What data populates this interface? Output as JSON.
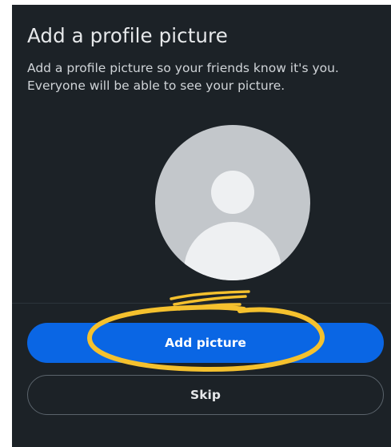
{
  "screen": {
    "title": "Add a profile picture",
    "description": "Add a profile picture so your friends know it's you. Everyone will be able to see your picture."
  },
  "avatar": {
    "icon": "user-silhouette-icon"
  },
  "actions": {
    "primary_label": "Add picture",
    "secondary_label": "Skip"
  },
  "annotation": {
    "color": "#f5c12e",
    "shape": "hand-drawn ellipse around the Add picture button"
  },
  "colors": {
    "background": "#1c2227",
    "primary_button": "#0a66e4",
    "avatar": "#c3c7cb"
  }
}
